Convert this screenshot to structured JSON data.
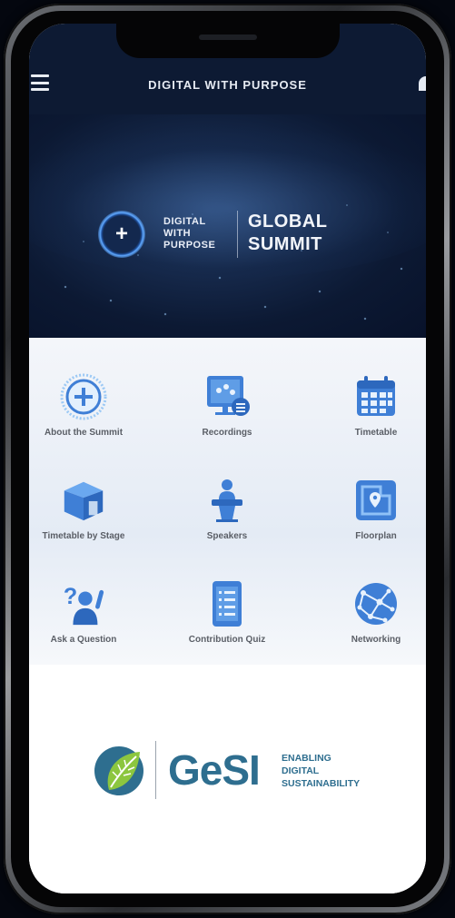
{
  "header": {
    "title": "DIGITAL WITH PURPOSE"
  },
  "hero": {
    "mark_symbol": "+",
    "brand_lines": [
      "DIGITAL",
      "WITH",
      "PURPOSE"
    ],
    "event_lines": [
      "GLOBAL",
      "SUMMIT"
    ]
  },
  "menu": [
    {
      "label": "About the Summit",
      "icon": "plus-circle-icon"
    },
    {
      "label": "Recordings",
      "icon": "recordings-icon"
    },
    {
      "label": "Timetable",
      "icon": "calendar-icon"
    },
    {
      "label": "Timetable by Stage",
      "icon": "stage-icon"
    },
    {
      "label": "Speakers",
      "icon": "podium-icon"
    },
    {
      "label": "Floorplan",
      "icon": "map-pin-icon"
    },
    {
      "label": "Ask a Question",
      "icon": "question-person-icon"
    },
    {
      "label": "Contribution Quiz",
      "icon": "clipboard-list-icon"
    },
    {
      "label": "Networking",
      "icon": "network-globe-icon"
    }
  ],
  "sponsor": {
    "name": "GeSI",
    "tagline_lines": [
      "ENABLING",
      "DIGITAL",
      "SUSTAINABILITY"
    ]
  },
  "colors": {
    "header_bg": "#0d1a33",
    "icon_blue": "#3f7fd6",
    "brand_teal": "#2e6e8f",
    "brand_green": "#8cc63f"
  }
}
